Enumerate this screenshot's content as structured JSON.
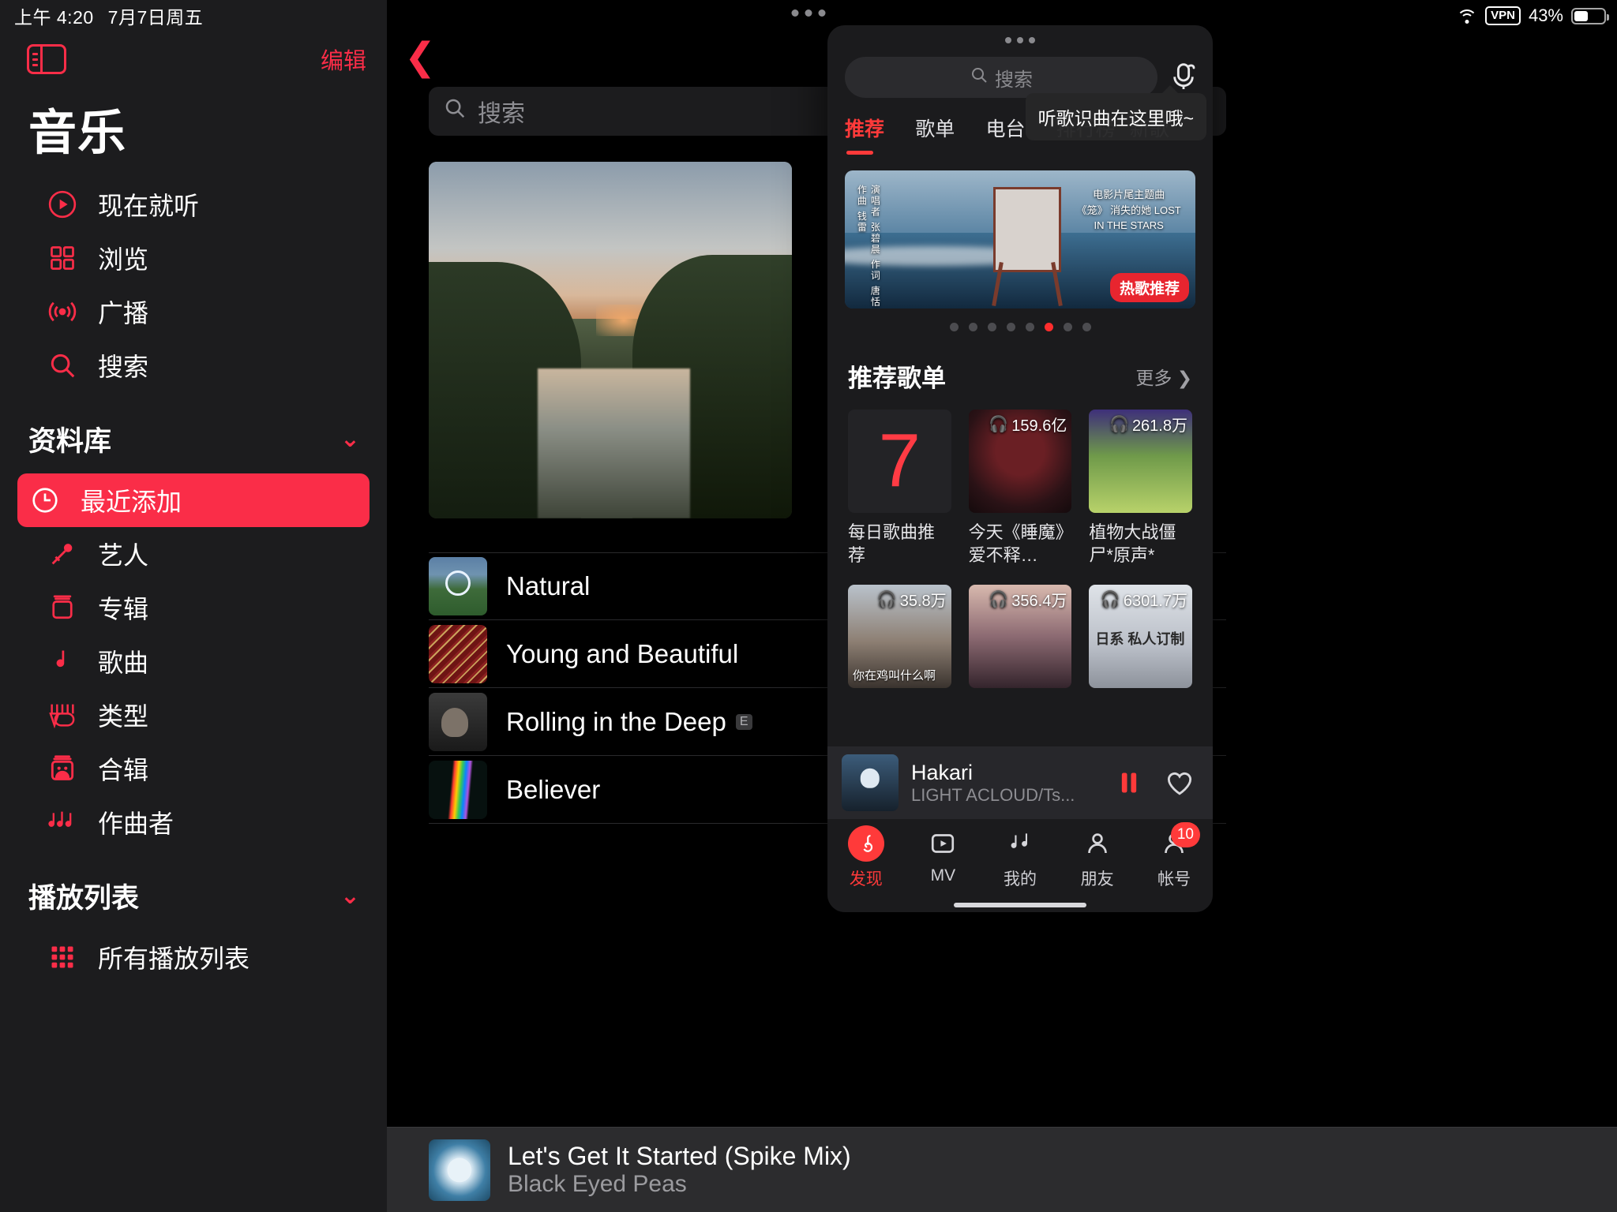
{
  "statusbar": {
    "time": "上午 4:20",
    "date": "7月7日周五",
    "vpn": "VPN",
    "battery": "43%"
  },
  "sidebar": {
    "edit_label": "编辑",
    "title": "音乐",
    "nav": [
      {
        "label": "现在就听",
        "icon": "play-circle-icon"
      },
      {
        "label": "浏览",
        "icon": "grid-icon"
      },
      {
        "label": "广播",
        "icon": "broadcast-icon"
      },
      {
        "label": "搜索",
        "icon": "search-icon"
      }
    ],
    "library_header": "资料库",
    "library": [
      {
        "label": "最近添加",
        "icon": "clock-icon",
        "active": true
      },
      {
        "label": "艺人",
        "icon": "microphone-icon"
      },
      {
        "label": "专辑",
        "icon": "album-icon"
      },
      {
        "label": "歌曲",
        "icon": "note-icon"
      },
      {
        "label": "类型",
        "icon": "guitar-icon"
      },
      {
        "label": "合辑",
        "icon": "compilation-icon"
      },
      {
        "label": "作曲者",
        "icon": "notes-icon"
      }
    ],
    "playlists_header": "播放列表",
    "playlists": [
      {
        "label": "所有播放列表",
        "icon": "playlists-grid-icon"
      }
    ]
  },
  "center": {
    "search_placeholder": "搜索",
    "songs": [
      {
        "title": "Natural",
        "explicit": ""
      },
      {
        "title": "Young and Beautiful",
        "explicit": ""
      },
      {
        "title": "Rolling in the Deep",
        "explicit": "E"
      },
      {
        "title": "Believer",
        "explicit": ""
      }
    ],
    "now_playing": {
      "title": "Let's Get It Started (Spike Mix)",
      "artist": "Black Eyed Peas"
    }
  },
  "overlay": {
    "search_placeholder": "搜索",
    "mic_icon": "song-recognition-icon",
    "tooltip": "听歌识曲在这里哦~",
    "tabs": [
      {
        "label": "推荐",
        "active": true
      },
      {
        "label": "歌单",
        "active": false
      },
      {
        "label": "电台",
        "active": false
      },
      {
        "label": "排行榜",
        "active": false
      },
      {
        "label": "新歌",
        "active": false
      }
    ],
    "banner": {
      "tag": "热歌推荐",
      "left_credits": "演唱者 张碧晨   作词 唐恬   作曲 钱雷",
      "right_title": "电影片尾主题曲 《笼》 消失的她 LOST IN THE STARS"
    },
    "carousel": {
      "total": 8,
      "active_index": 5
    },
    "section": {
      "title": "推荐歌单",
      "more": "更多"
    },
    "playlists": [
      {
        "name": "每日歌曲推荐",
        "count": "",
        "badge": "7",
        "cover": "daily-7"
      },
      {
        "name": "今天《睡魔》爱不释…",
        "count": "159.6亿",
        "cover": "roar"
      },
      {
        "name": "植物大战僵尸*原声*",
        "count": "261.8万",
        "cover": "pvz"
      },
      {
        "name": "你在鸡叫什么啊",
        "count": "35.8万",
        "cover": "guy"
      },
      {
        "name": "",
        "count": "356.4万",
        "cover": "anime"
      },
      {
        "name": "日系\n私人订制",
        "count": "6301.7万",
        "cover": "jp"
      }
    ],
    "player": {
      "title": "Hakari",
      "subtitle": "LIGHT ACLOUD/Ts...",
      "pause_icon": "pause-icon",
      "like_icon": "heart-icon"
    },
    "tabbar": [
      {
        "label": "发现",
        "icon": "netease-disc-icon",
        "active": true,
        "badge": ""
      },
      {
        "label": "MV",
        "icon": "video-icon",
        "active": false,
        "badge": ""
      },
      {
        "label": "我的",
        "icon": "my-music-icon",
        "active": false,
        "badge": ""
      },
      {
        "label": "朋友",
        "icon": "friends-icon",
        "active": false,
        "badge": ""
      },
      {
        "label": "帐号",
        "icon": "account-icon",
        "active": false,
        "badge": "10"
      }
    ]
  },
  "colors": {
    "apple_red": "#fa2d48",
    "netease_red": "#ff3a3a",
    "sidebar_bg": "#1c1c1e",
    "overlay_bg": "#1b1b1d"
  }
}
